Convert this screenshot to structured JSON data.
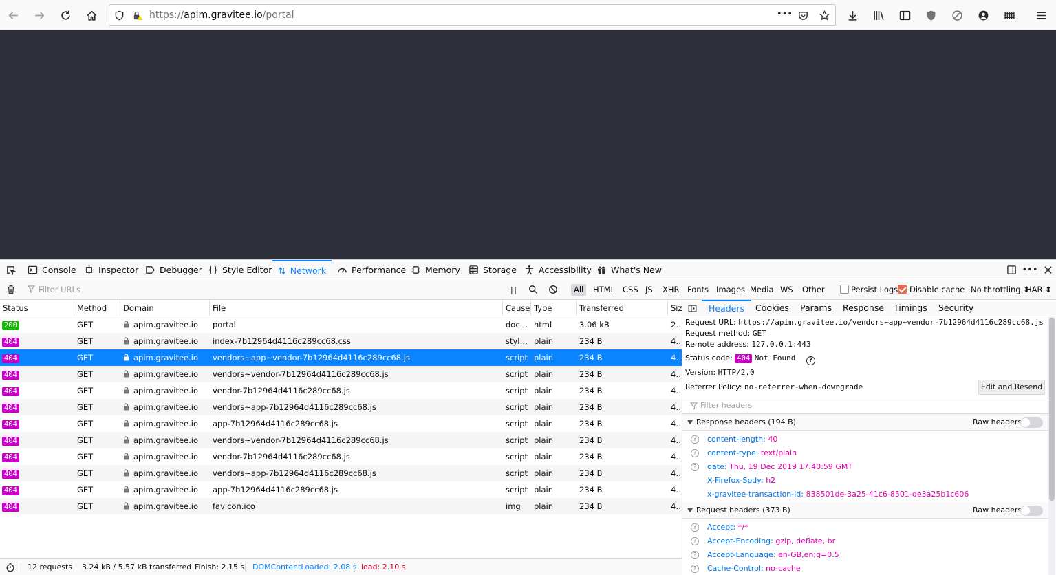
{
  "browser": {
    "url_scheme": "https://",
    "url_host": "apim.gravitee.io",
    "url_path": "/portal",
    "page_actions_label": "•••"
  },
  "devtools": {
    "tabs": [
      {
        "label": "Console",
        "icon": "console-icon"
      },
      {
        "label": "Inspector",
        "icon": "inspector-icon"
      },
      {
        "label": "Debugger",
        "icon": "debugger-icon"
      },
      {
        "label": "Style Editor",
        "icon": "style-editor-icon"
      },
      {
        "label": "Network",
        "icon": "network-icon",
        "active": true
      },
      {
        "label": "Performance",
        "icon": "performance-icon"
      },
      {
        "label": "Memory",
        "icon": "memory-icon"
      },
      {
        "label": "Storage",
        "icon": "storage-icon"
      },
      {
        "label": "Accessibility",
        "icon": "accessibility-icon"
      },
      {
        "label": "What's New",
        "icon": "whats-new-icon"
      }
    ],
    "more_label": "•••"
  },
  "network_toolbar": {
    "filter_placeholder": "Filter URLs",
    "pause_label": "| |",
    "type_filters": [
      "All",
      "HTML",
      "CSS",
      "JS",
      "XHR",
      "Fonts",
      "Images",
      "Media",
      "WS",
      "Other"
    ],
    "active_type": "All",
    "persist_logs_label": "Persist Logs",
    "persist_logs_checked": false,
    "disable_cache_label": "Disable cache",
    "disable_cache_checked": true,
    "throttling_label": "No throttling ⬍",
    "har_label": "HAR ⬍"
  },
  "requests": {
    "columns": [
      "Status",
      "Method",
      "Domain",
      "File",
      "Cause",
      "Type",
      "Transferred",
      "Siz"
    ],
    "rows": [
      {
        "status": "200",
        "method": "GET",
        "domain": "apim.gravitee.io",
        "file": "portal",
        "cause": "docu…",
        "type": "html",
        "transferred": "3.06 kB",
        "size": "2…"
      },
      {
        "status": "404",
        "method": "GET",
        "domain": "apim.gravitee.io",
        "file": "index-7b12964d4116c289cc68.css",
        "cause": "style…",
        "type": "plain",
        "transferred": "234 B",
        "size": "4…"
      },
      {
        "status": "404",
        "method": "GET",
        "domain": "apim.gravitee.io",
        "file": "vendors~app~vendor-7b12964d4116c289cc68.js",
        "cause": "script",
        "type": "plain",
        "transferred": "234 B",
        "size": "4…",
        "selected": true
      },
      {
        "status": "404",
        "method": "GET",
        "domain": "apim.gravitee.io",
        "file": "vendors~vendor-7b12964d4116c289cc68.js",
        "cause": "script",
        "type": "plain",
        "transferred": "234 B",
        "size": "4…"
      },
      {
        "status": "404",
        "method": "GET",
        "domain": "apim.gravitee.io",
        "file": "vendor-7b12964d4116c289cc68.js",
        "cause": "script",
        "type": "plain",
        "transferred": "234 B",
        "size": "4…"
      },
      {
        "status": "404",
        "method": "GET",
        "domain": "apim.gravitee.io",
        "file": "vendors~app-7b12964d4116c289cc68.js",
        "cause": "script",
        "type": "plain",
        "transferred": "234 B",
        "size": "4…"
      },
      {
        "status": "404",
        "method": "GET",
        "domain": "apim.gravitee.io",
        "file": "app-7b12964d4116c289cc68.js",
        "cause": "script",
        "type": "plain",
        "transferred": "234 B",
        "size": "4…"
      },
      {
        "status": "404",
        "method": "GET",
        "domain": "apim.gravitee.io",
        "file": "vendors~vendor-7b12964d4116c289cc68.js",
        "cause": "script",
        "type": "plain",
        "transferred": "234 B",
        "size": "4…"
      },
      {
        "status": "404",
        "method": "GET",
        "domain": "apim.gravitee.io",
        "file": "vendor-7b12964d4116c289cc68.js",
        "cause": "script",
        "type": "plain",
        "transferred": "234 B",
        "size": "4…"
      },
      {
        "status": "404",
        "method": "GET",
        "domain": "apim.gravitee.io",
        "file": "vendors~app-7b12964d4116c289cc68.js",
        "cause": "script",
        "type": "plain",
        "transferred": "234 B",
        "size": "4…"
      },
      {
        "status": "404",
        "method": "GET",
        "domain": "apim.gravitee.io",
        "file": "app-7b12964d4116c289cc68.js",
        "cause": "script",
        "type": "plain",
        "transferred": "234 B",
        "size": "4…"
      },
      {
        "status": "404",
        "method": "GET",
        "domain": "apim.gravitee.io",
        "file": "favicon.ico",
        "cause": "img",
        "type": "plain",
        "transferred": "234 B",
        "size": "4…"
      }
    ]
  },
  "status_bar": {
    "requests": "12 requests",
    "transferred": "3.24 kB / 5.57 kB transferred",
    "finish": "Finish: 2.15 s",
    "dom_content_loaded": "DOMContentLoaded: 2.08 s",
    "load": "load: 2.10 s"
  },
  "details": {
    "tabs": [
      "Headers",
      "Cookies",
      "Params",
      "Response",
      "Timings",
      "Security"
    ],
    "active_tab": "Headers",
    "request_url_label": "Request URL:",
    "request_url": "https://apim.gravitee.io/vendors~app~vendor-7b12964d4116c289cc68.js",
    "request_method_label": "Request method:",
    "request_method": "GET",
    "remote_address_label": "Remote address:",
    "remote_address": "127.0.0.1:443",
    "status_code_label": "Status code:",
    "status_code": "404",
    "status_text": "Not Found",
    "help_label": "?",
    "version_label": "Version:",
    "version": "HTTP/2.0",
    "referrer_policy_label": "Referrer Policy:",
    "referrer_policy": "no-referrer-when-downgrade",
    "edit_resend_label": "Edit and Resend",
    "filter_headers_placeholder": "Filter headers",
    "response_headers_title": "Response headers (194 B)",
    "request_headers_title": "Request headers (373 B)",
    "raw_headers_label": "Raw headers",
    "response_headers": [
      {
        "key": "content-length:",
        "value": "40",
        "help": true
      },
      {
        "key": "content-type:",
        "value": "text/plain",
        "help": true
      },
      {
        "key": "date:",
        "value": "Thu, 19 Dec 2019 17:40:59 GMT",
        "help": true
      },
      {
        "key": "X-Firefox-Spdy:",
        "value": "h2",
        "help": false
      },
      {
        "key": "x-gravitee-transaction-id:",
        "value": "838501de-3a25-41c6-8501-de3a25b1c606",
        "help": false
      }
    ],
    "request_headers": [
      {
        "key": "Accept:",
        "value": "*/*",
        "help": true
      },
      {
        "key": "Accept-Encoding:",
        "value": "gzip, deflate, br",
        "help": true
      },
      {
        "key": "Accept-Language:",
        "value": "en-GB,en;q=0.5",
        "help": true
      },
      {
        "key": "Cache-Control:",
        "value": "no-cache",
        "help": true
      }
    ]
  },
  "colors": {
    "accent": "#0a84ff",
    "status_ok": "#12bc00",
    "status_404": "#c800c8",
    "page_background": "#2d2f3a"
  }
}
